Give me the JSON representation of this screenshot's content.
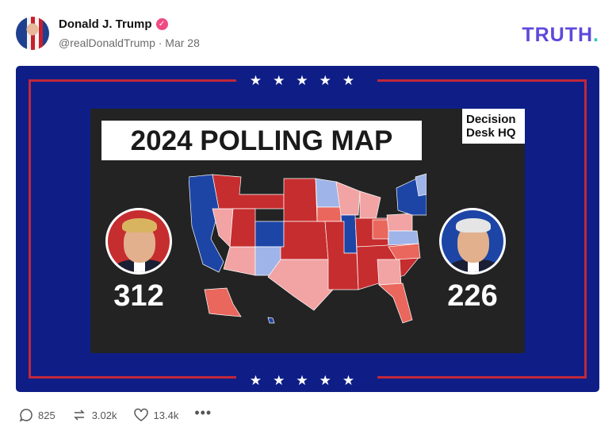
{
  "post": {
    "author": "Donald J. Trump",
    "handle_date": "@realDonaldTrump · Mar 28",
    "brand": "TRUTH",
    "brand_dot": "."
  },
  "poster": {
    "stars_top": "★★★★★",
    "stars_bottom": "★★★★★",
    "title": "2024 POLLING MAP",
    "logo_line1": "Decision",
    "logo_line2": "Desk HQ",
    "left_score": "312",
    "right_score": "226"
  },
  "actions": {
    "replies": "825",
    "retruths": "3.02k",
    "likes": "13.4k",
    "more": "•••"
  },
  "colors": {
    "brand": "#5e49db",
    "poster_blue": "#0f1e86",
    "solid_red": "#c62d2f",
    "lean_red": "#f2a3a3",
    "likely_red": "#e9675c",
    "solid_blue": "#1c45a6",
    "lean_blue": "#9fb4e8",
    "likely_blue": "#5c7fd1"
  }
}
